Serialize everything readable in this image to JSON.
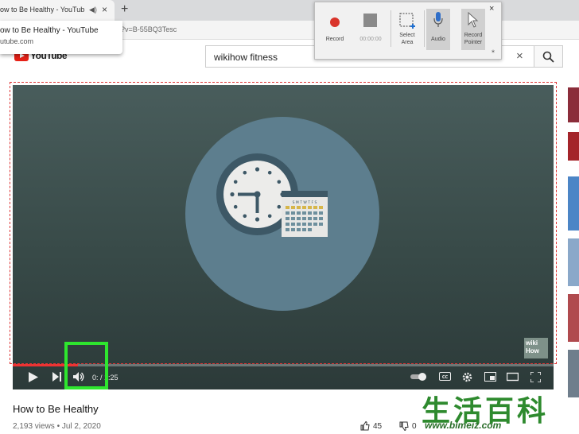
{
  "browser": {
    "tab_title": "ow to Be Healthy - YouTube",
    "tab_audio_icon": "speaker-icon",
    "new_tab_label": "+",
    "close_label": "×",
    "url_fragment": "?v=B-55BQ3Tesc",
    "popup_title": "ow to Be Healthy - YouTube",
    "popup_url": "utube.com"
  },
  "youtube": {
    "logo_text": "YouTube",
    "search_value": "wikihow fitness",
    "clear_label": "×"
  },
  "recorder": {
    "record_label": "Record",
    "timer": "00:00:00",
    "select_area_label_1": "Select",
    "select_area_label_2": "Area",
    "audio_label": "Audio",
    "record_pointer_label_1": "Record",
    "record_pointer_label_2": "Pointer",
    "close_label": "×",
    "pin_label": "⁎"
  },
  "video": {
    "time_current": "0:",
    "time_sep": "/ 1:25",
    "progress": 0.12,
    "badge_line1": "wiki",
    "badge_line2": "How",
    "cal_days": "S M T W T F S"
  },
  "info": {
    "title": "How to Be Healthy",
    "meta": "2,193 views • Jul 2, 2020",
    "likes": "45",
    "dislikes": "0"
  },
  "watermark": {
    "chars": "生活百科",
    "url": "www.bimeiz.com"
  },
  "colors": {
    "highlight": "#2ee62e",
    "record_red": "#d9342b",
    "youtube_red": "#e62117"
  }
}
